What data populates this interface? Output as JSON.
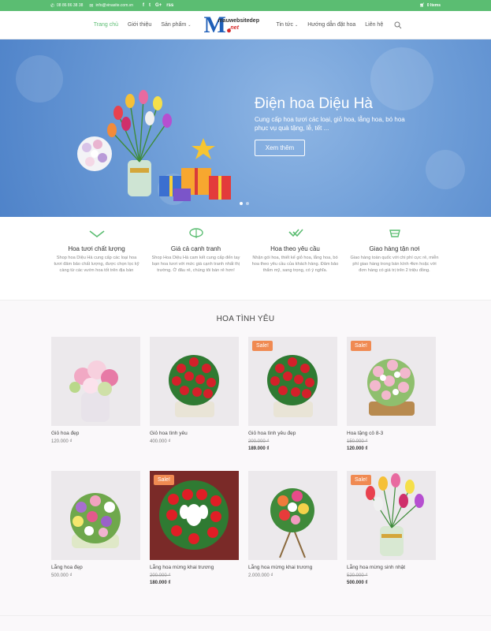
{
  "topbar": {
    "phone": "08 86 86 38 38",
    "email": "info@vinasite.com.vn",
    "social_icons": [
      "facebook-icon",
      "twitter-icon",
      "google-plus-icon",
      "rss-icon"
    ],
    "social_glyphs": [
      "f",
      "t",
      "G+",
      "rss"
    ],
    "cart_label": "0 Items"
  },
  "nav": {
    "left": [
      {
        "label": "Trang chủ",
        "active": true,
        "dropdown": false
      },
      {
        "label": "Giới thiệu",
        "active": false,
        "dropdown": false
      },
      {
        "label": "Sản phẩm",
        "active": false,
        "dropdown": true
      }
    ],
    "right": [
      {
        "label": "Tin tức",
        "active": false,
        "dropdown": true
      },
      {
        "label": "Hướng dẫn đặt hoa",
        "active": false,
        "dropdown": false
      },
      {
        "label": "Liên hệ",
        "active": false,
        "dropdown": false
      }
    ],
    "logo_text": "mauwebsitedep",
    "logo_suffix": ".net"
  },
  "hero": {
    "title": "Điện hoa Diệu Hà",
    "description": "Cung cấp hoa tươi các loại, giỏ hoa, lẵng hoa, bó hoa phục vụ quà tặng, lễ, tết ...",
    "button": "Xem thêm",
    "slides": 2,
    "active_slide": 1
  },
  "features": [
    {
      "icon": "check-icon",
      "title": "Hoa tươi chất lượng",
      "desc": "Shop hoa Diệu Hà cung cấp các loại hoa tươi đảm bảo chất lượng, được chọn lọc kỹ càng từ các vườn hoa tốt trên địa bàn"
    },
    {
      "icon": "price-icon",
      "title": "Giá cả cạnh tranh",
      "desc": "Shop Hoa Diệu Hà cam kết cung cấp đến tay bạn hoa tươi với mức giá cạnh tranh nhất thị trường. Ở đâu rẻ, chúng tôi bán rẻ hơn!"
    },
    {
      "icon": "double-check-icon",
      "title": "Hoa theo yêu cầu",
      "desc": "Nhận gói hoa, thiết kế giỏ hoa, lẵng hoa, bó hoa theo yêu cầu của khách hàng. Đảm bảo thẩm mỹ, sang trọng, có ý nghĩa."
    },
    {
      "icon": "delivery-icon",
      "title": "Giao hàng tận nơi",
      "desc": "Giao hàng toàn quốc với chi phí cực rẻ, miễn phí giao hàng trong bán kính 4km hoặc với đơn hàng có giá trị trên 2 triệu đồng."
    }
  ],
  "section_title": "HOA TÌNH YÊU",
  "sale_label": "Sale!",
  "products": [
    {
      "name": "Giỏ hoa đẹp",
      "price": "120.000 ₫",
      "sale": false,
      "old_price": "",
      "art": "pink-vase"
    },
    {
      "name": "Giỏ hoa tình yêu",
      "price": "400.000 ₫",
      "sale": false,
      "old_price": "",
      "art": "red-basket"
    },
    {
      "name": "Giỏ hoa tình yêu đẹp",
      "price": "189.000 ₫",
      "sale": true,
      "old_price": "200.000 ₫",
      "art": "red-basket"
    },
    {
      "name": "Hoa tặng cô 8-3",
      "price": "120.000 ₫",
      "sale": true,
      "old_price": "150.000 ₫",
      "art": "pink-basket"
    },
    {
      "name": "Lẵng hoa đẹp",
      "price": "500.000 ₫",
      "sale": false,
      "old_price": "",
      "art": "mixed-basket"
    },
    {
      "name": "Lẵng hoa mừng khai trương",
      "price": "180.000 ₫",
      "sale": true,
      "old_price": "200.000 ₫",
      "art": "opening-red"
    },
    {
      "name": "Lẵng hoa mừng khai trương",
      "price": "2.000.000 ₫",
      "sale": false,
      "old_price": "",
      "art": "opening-stand"
    },
    {
      "name": "Lẵng hoa mừng sinh nhật",
      "price": "500.000 ₫",
      "sale": true,
      "old_price": "520.000 ₫",
      "art": "tulip-vase"
    }
  ],
  "colors": {
    "accent": "#5bbd72",
    "sale": "#f08a52",
    "hero": "#6f9ed8",
    "logo_blue": "#1f5fb8",
    "logo_red": "#d62a2a"
  }
}
